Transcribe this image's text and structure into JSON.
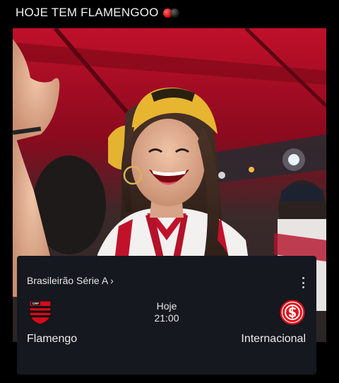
{
  "post": {
    "title": "HOJE TEM FLAMENGOO"
  },
  "icons": {
    "title_emoji": [
      "red-circle",
      "black-circle"
    ],
    "more": "vertical-dots",
    "home_crest": "flamengo-crest",
    "away_crest": "internacional-crest"
  },
  "match_card": {
    "competition": "Brasileirão Série A",
    "chevron": "›",
    "day": "Hoje",
    "time": "21:00",
    "home_team": "Flamengo",
    "away_team": "Internacional"
  },
  "colors": {
    "flamengo_red": "#d40c1c",
    "flamengo_black": "#111111",
    "internacional_red": "#e3101a",
    "card_bg": "#16181f"
  }
}
